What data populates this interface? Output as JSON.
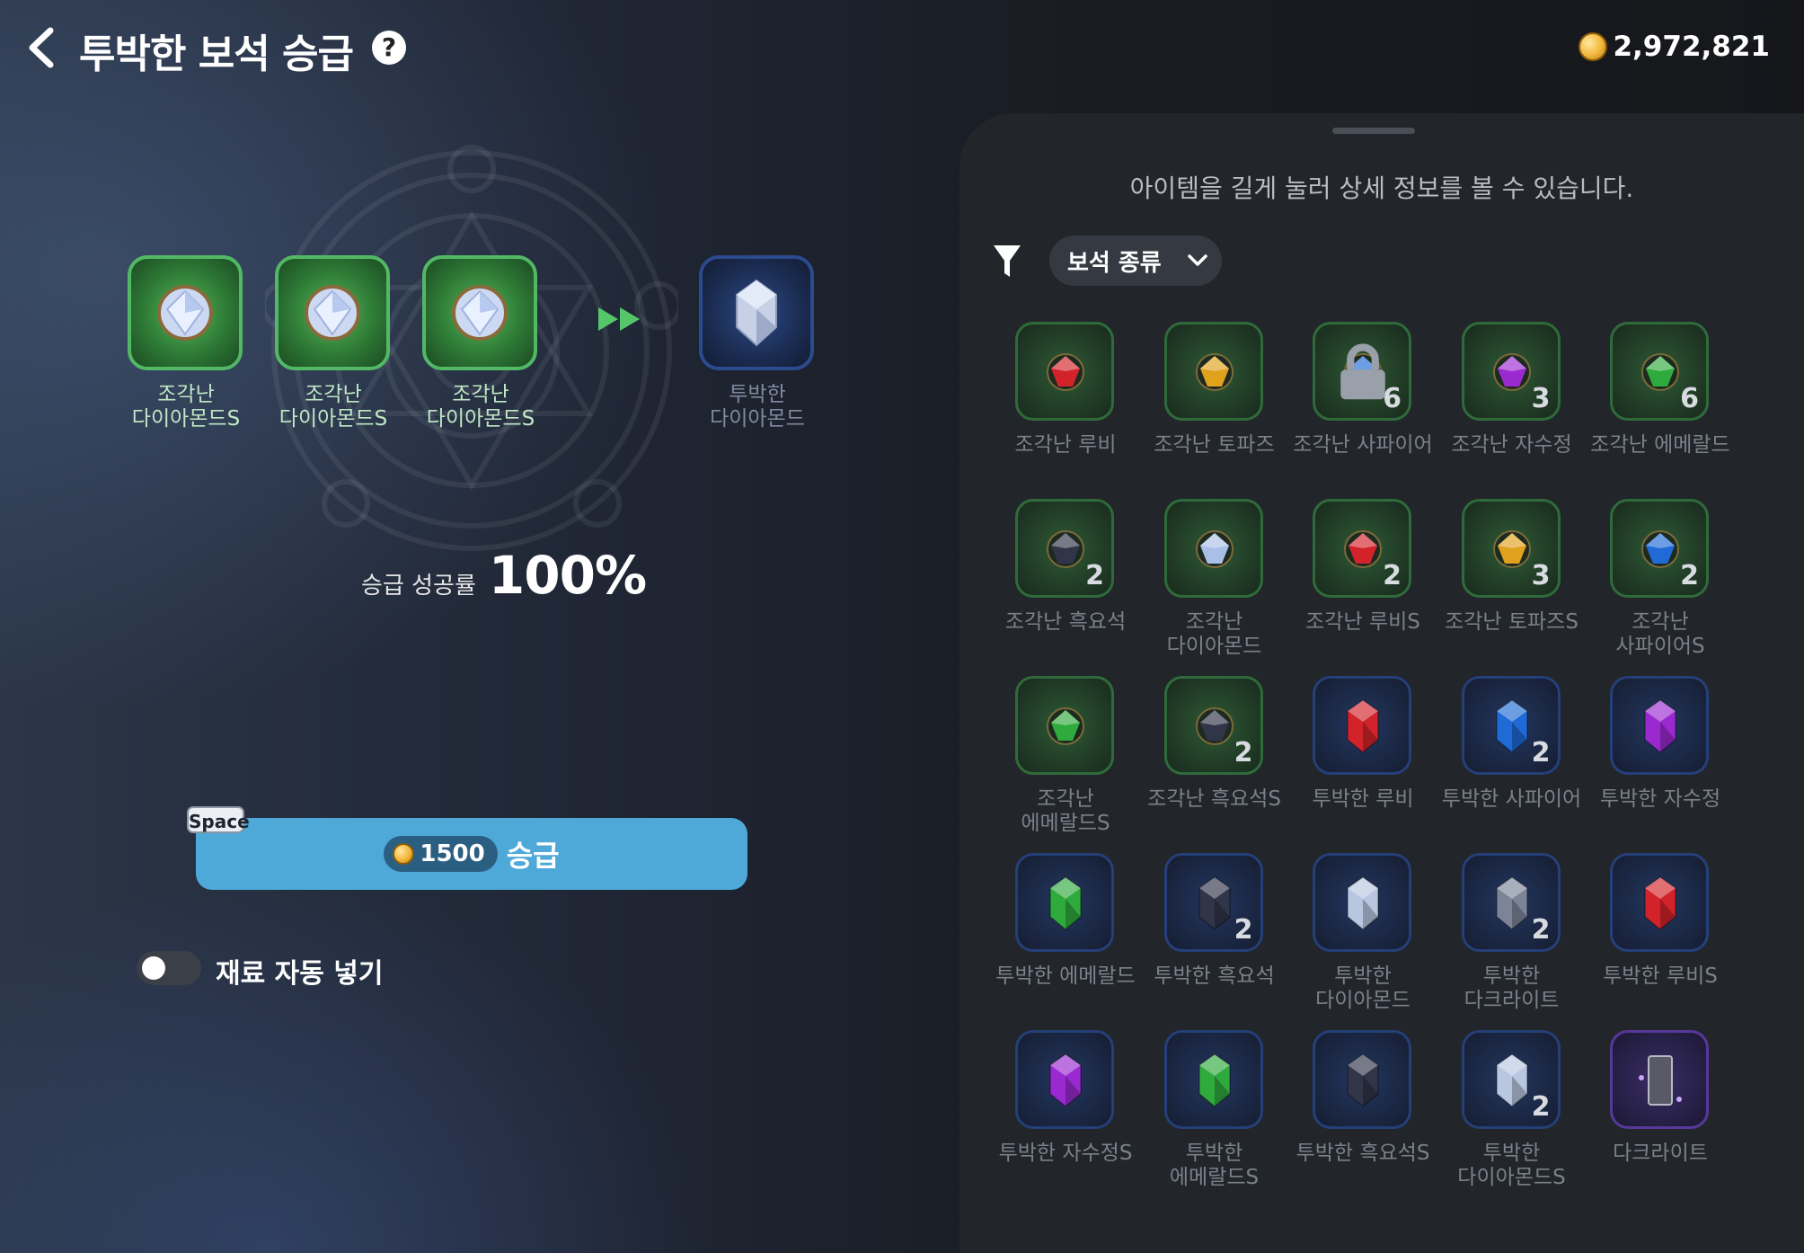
{
  "header": {
    "title": "투박한 보석 승급",
    "help_symbol": "?",
    "gold_amount": "2,972,821"
  },
  "colors": {
    "accent_button": "#4ea8d8",
    "slot_green": "#53b865",
    "slot_blue": "#2b4b8e",
    "panel_bg": "#22252a"
  },
  "promotion": {
    "materials": [
      {
        "label": "조각난\n다이아몬드S",
        "icon": "diamond-gem-icon"
      },
      {
        "label": "조각난\n다이아몬드S",
        "icon": "diamond-gem-icon"
      },
      {
        "label": "조각난\n다이아몬드S",
        "icon": "diamond-gem-icon"
      }
    ],
    "result": {
      "label": "투박한\n다이아몬드",
      "icon": "rough-diamond-icon"
    },
    "success_label": "승급 성공률",
    "success_rate": "100%",
    "hotkey": "Space",
    "cost": "1500",
    "button_label": "승급",
    "auto_fill_label": "재료 자동 넣기",
    "auto_fill_enabled": false
  },
  "inventory": {
    "hint": "아이템을 길게 눌러 상세 정보를 볼 수 있습니다.",
    "filter_label": "보석 종류",
    "items": [
      {
        "label": "조각난 루비",
        "count": "",
        "color": "#d2232a",
        "frame": "green",
        "shape": "round",
        "locked": false
      },
      {
        "label": "조각난 토파즈",
        "count": "",
        "color": "#e0a11c",
        "frame": "green",
        "shape": "round",
        "locked": false
      },
      {
        "label": "조각난 사파이어",
        "count": "6",
        "color": "#1f6ad6",
        "frame": "green",
        "shape": "round",
        "locked": true
      },
      {
        "label": "조각난 자수정",
        "count": "3",
        "color": "#9a2ad0",
        "frame": "green",
        "shape": "round",
        "locked": false
      },
      {
        "label": "조각난 에메랄드",
        "count": "6",
        "color": "#2faa3c",
        "frame": "green",
        "shape": "round",
        "locked": false
      },
      {
        "label": "조각난 흑요석",
        "count": "2",
        "color": "#303548",
        "frame": "green",
        "shape": "round",
        "locked": false
      },
      {
        "label": "조각난\n다이아몬드",
        "count": "",
        "color": "#a9bfe6",
        "frame": "green",
        "shape": "round",
        "locked": false
      },
      {
        "label": "조각난 루비S",
        "count": "2",
        "color": "#d2232a",
        "frame": "green",
        "shape": "round",
        "locked": false
      },
      {
        "label": "조각난 토파즈S",
        "count": "3",
        "color": "#e0a11c",
        "frame": "green",
        "shape": "round",
        "locked": false
      },
      {
        "label": "조각난\n사파이어S",
        "count": "2",
        "color": "#1f6ad6",
        "frame": "green",
        "shape": "round",
        "locked": false
      },
      {
        "label": "조각난\n에메랄드S",
        "count": "",
        "color": "#2faa3c",
        "frame": "green",
        "shape": "round",
        "locked": false
      },
      {
        "label": "조각난 흑요석S",
        "count": "2",
        "color": "#303548",
        "frame": "green",
        "shape": "round",
        "locked": false
      },
      {
        "label": "투박한 루비",
        "count": "",
        "color": "#d2232a",
        "frame": "blue",
        "shape": "crystal",
        "locked": false
      },
      {
        "label": "투박한 사파이어",
        "count": "2",
        "color": "#1f6ad6",
        "frame": "blue",
        "shape": "crystal",
        "locked": false
      },
      {
        "label": "투박한 자수정",
        "count": "",
        "color": "#9a2ad0",
        "frame": "blue",
        "shape": "crystal",
        "locked": false
      },
      {
        "label": "투박한 에메랄드",
        "count": "",
        "color": "#2faa3c",
        "frame": "blue",
        "shape": "crystal",
        "locked": false
      },
      {
        "label": "투박한 흑요석",
        "count": "2",
        "color": "#303548",
        "frame": "blue",
        "shape": "crystal",
        "locked": false
      },
      {
        "label": "투박한\n다이아몬드",
        "count": "",
        "color": "#b9c6e0",
        "frame": "blue",
        "shape": "crystal",
        "locked": false
      },
      {
        "label": "투박한\n다크라이트",
        "count": "2",
        "color": "#7d8498",
        "frame": "blue",
        "shape": "crystal",
        "locked": false
      },
      {
        "label": "투박한 루비S",
        "count": "",
        "color": "#d2232a",
        "frame": "blue",
        "shape": "crystal",
        "locked": false
      },
      {
        "label": "투박한 자수정S",
        "count": "",
        "color": "#9a2ad0",
        "frame": "blue",
        "shape": "crystal",
        "locked": false
      },
      {
        "label": "투박한\n에메랄드S",
        "count": "",
        "color": "#2faa3c",
        "frame": "blue",
        "shape": "crystal",
        "locked": false
      },
      {
        "label": "투박한 흑요석S",
        "count": "",
        "color": "#303548",
        "frame": "blue",
        "shape": "crystal",
        "locked": false
      },
      {
        "label": "투박한\n다이아몬드S",
        "count": "2",
        "color": "#b9c6e0",
        "frame": "blue",
        "shape": "crystal",
        "locked": false
      },
      {
        "label": "다크라이트",
        "count": "",
        "color": "#5a5a66",
        "frame": "purple",
        "shape": "block",
        "locked": false
      }
    ]
  }
}
